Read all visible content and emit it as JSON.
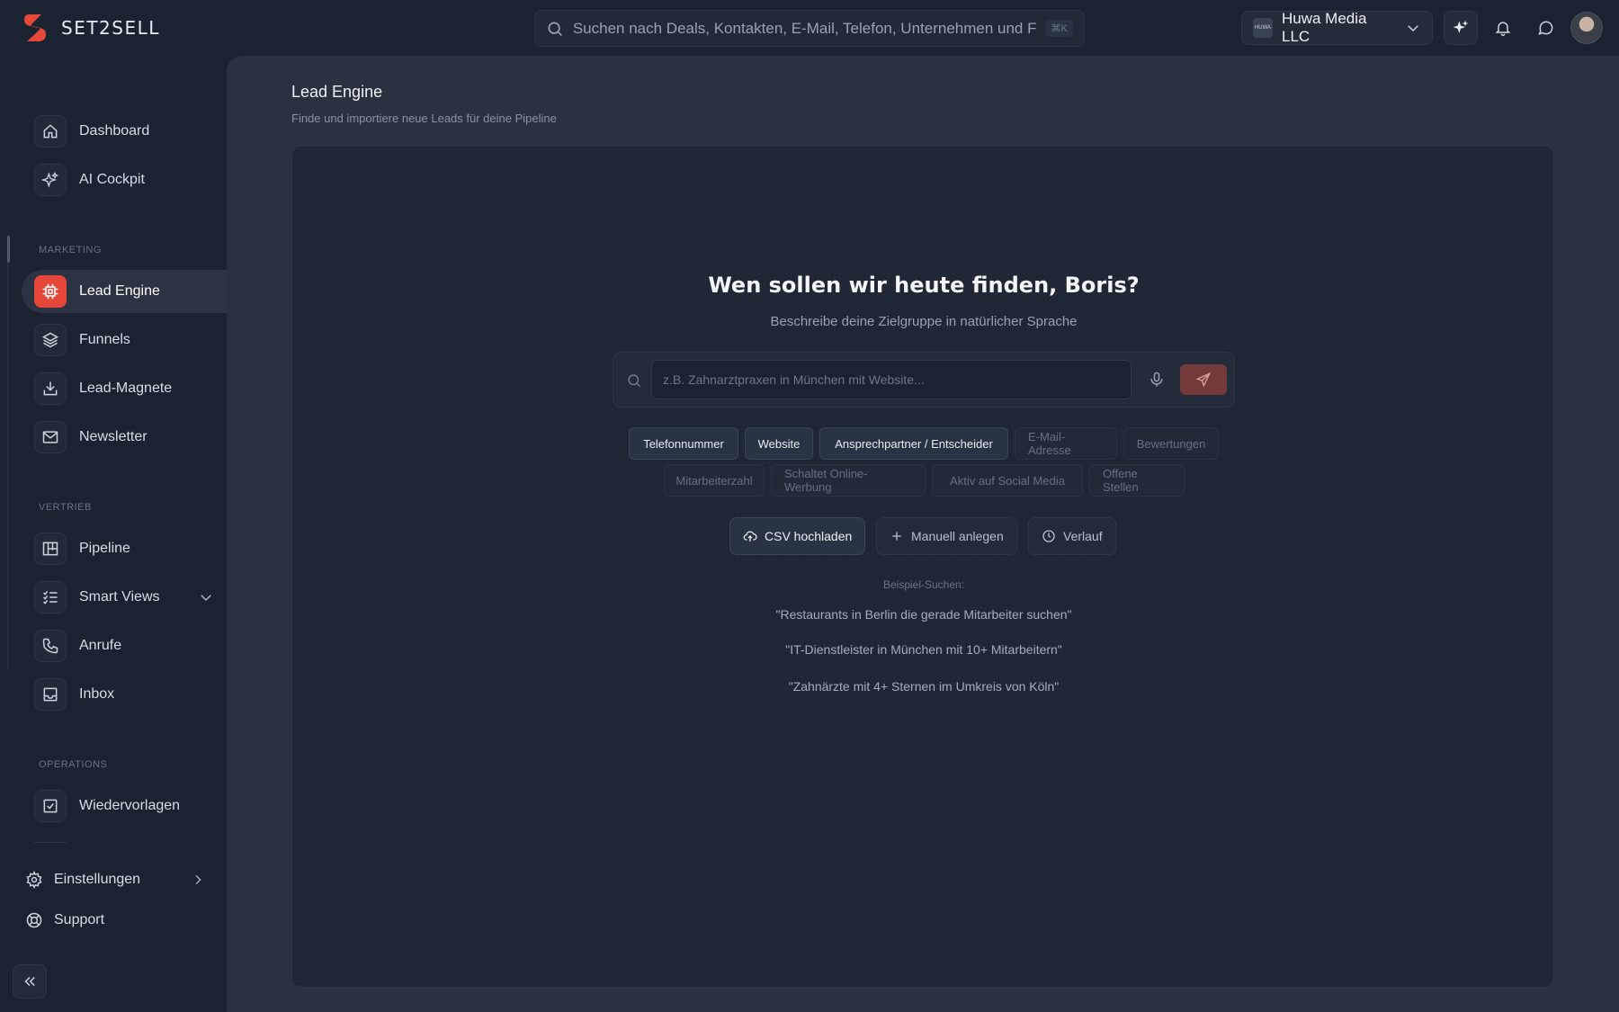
{
  "brand": {
    "name": "SET2SELL",
    "accent": "#e5483a"
  },
  "search": {
    "placeholder": "Suchen nach Deals, Kontakten, E-Mail, Telefon, Unternehmen und Fun",
    "shortcut": "⌘K"
  },
  "workspace": {
    "logo_text": "HUWA",
    "name": "Huwa Media LLC"
  },
  "sidebar": {
    "items_top": [
      {
        "label": "Dashboard",
        "icon": "home-icon"
      },
      {
        "label": "AI Cockpit",
        "icon": "sparkle-icon"
      }
    ],
    "sections": [
      {
        "label": "MARKETING",
        "items": [
          {
            "label": "Lead Engine",
            "icon": "chip-icon",
            "active": true
          },
          {
            "label": "Funnels",
            "icon": "layers-icon"
          },
          {
            "label": "Lead-Magnete",
            "icon": "download-icon"
          },
          {
            "label": "Newsletter",
            "icon": "mail-icon"
          }
        ]
      },
      {
        "label": "VERTRIEB",
        "items": [
          {
            "label": "Pipeline",
            "icon": "kanban-icon"
          },
          {
            "label": "Smart Views",
            "icon": "list-check-icon"
          },
          {
            "label": "Anrufe",
            "icon": "phone-icon"
          },
          {
            "label": "Inbox",
            "icon": "inbox-icon"
          }
        ]
      },
      {
        "label": "OPERATIONS",
        "items": [
          {
            "label": "Wiedervorlagen",
            "icon": "checkbox-icon"
          }
        ]
      }
    ],
    "settings_label": "Einstellungen",
    "support_label": "Support"
  },
  "page": {
    "title": "Lead Engine",
    "subtitle": "Finde und importiere neue Leads für deine Pipeline"
  },
  "finder": {
    "heading": "Wen sollen wir heute finden, Boris?",
    "subheading": "Beschreibe deine Zielgruppe in natürlicher Sprache",
    "input_placeholder": "z.B. Zahnarztpraxen in München mit Website...",
    "chips": [
      {
        "label": "Telefonnummer",
        "selected": true
      },
      {
        "label": "Website",
        "selected": true
      },
      {
        "label": "Ansprechpartner / Entscheider",
        "selected": true
      },
      {
        "label": "E-Mail-Adresse",
        "selected": false
      },
      {
        "label": "Bewertungen",
        "selected": false
      },
      {
        "label": "Mitarbeiterzahl",
        "selected": false
      },
      {
        "label": "Schaltet Online-Werbung",
        "selected": false
      },
      {
        "label": "Aktiv auf Social Media",
        "selected": false
      },
      {
        "label": "Offene Stellen",
        "selected": false
      }
    ],
    "actions": [
      {
        "label": "CSV hochladen",
        "icon": "upload-cloud-icon"
      },
      {
        "label": "Manuell anlegen",
        "icon": "plus-icon"
      },
      {
        "label": "Verlauf",
        "icon": "clock-icon"
      }
    ],
    "examples_label": "Beispiel-Suchen:",
    "examples": [
      "\"Restaurants in Berlin die gerade Mitarbeiter suchen\"",
      "\"IT-Dienstleister in München mit 10+ Mitarbeitern\"",
      "\"Zahnärzte mit 4+ Sternen im Umkreis von Köln\""
    ]
  }
}
